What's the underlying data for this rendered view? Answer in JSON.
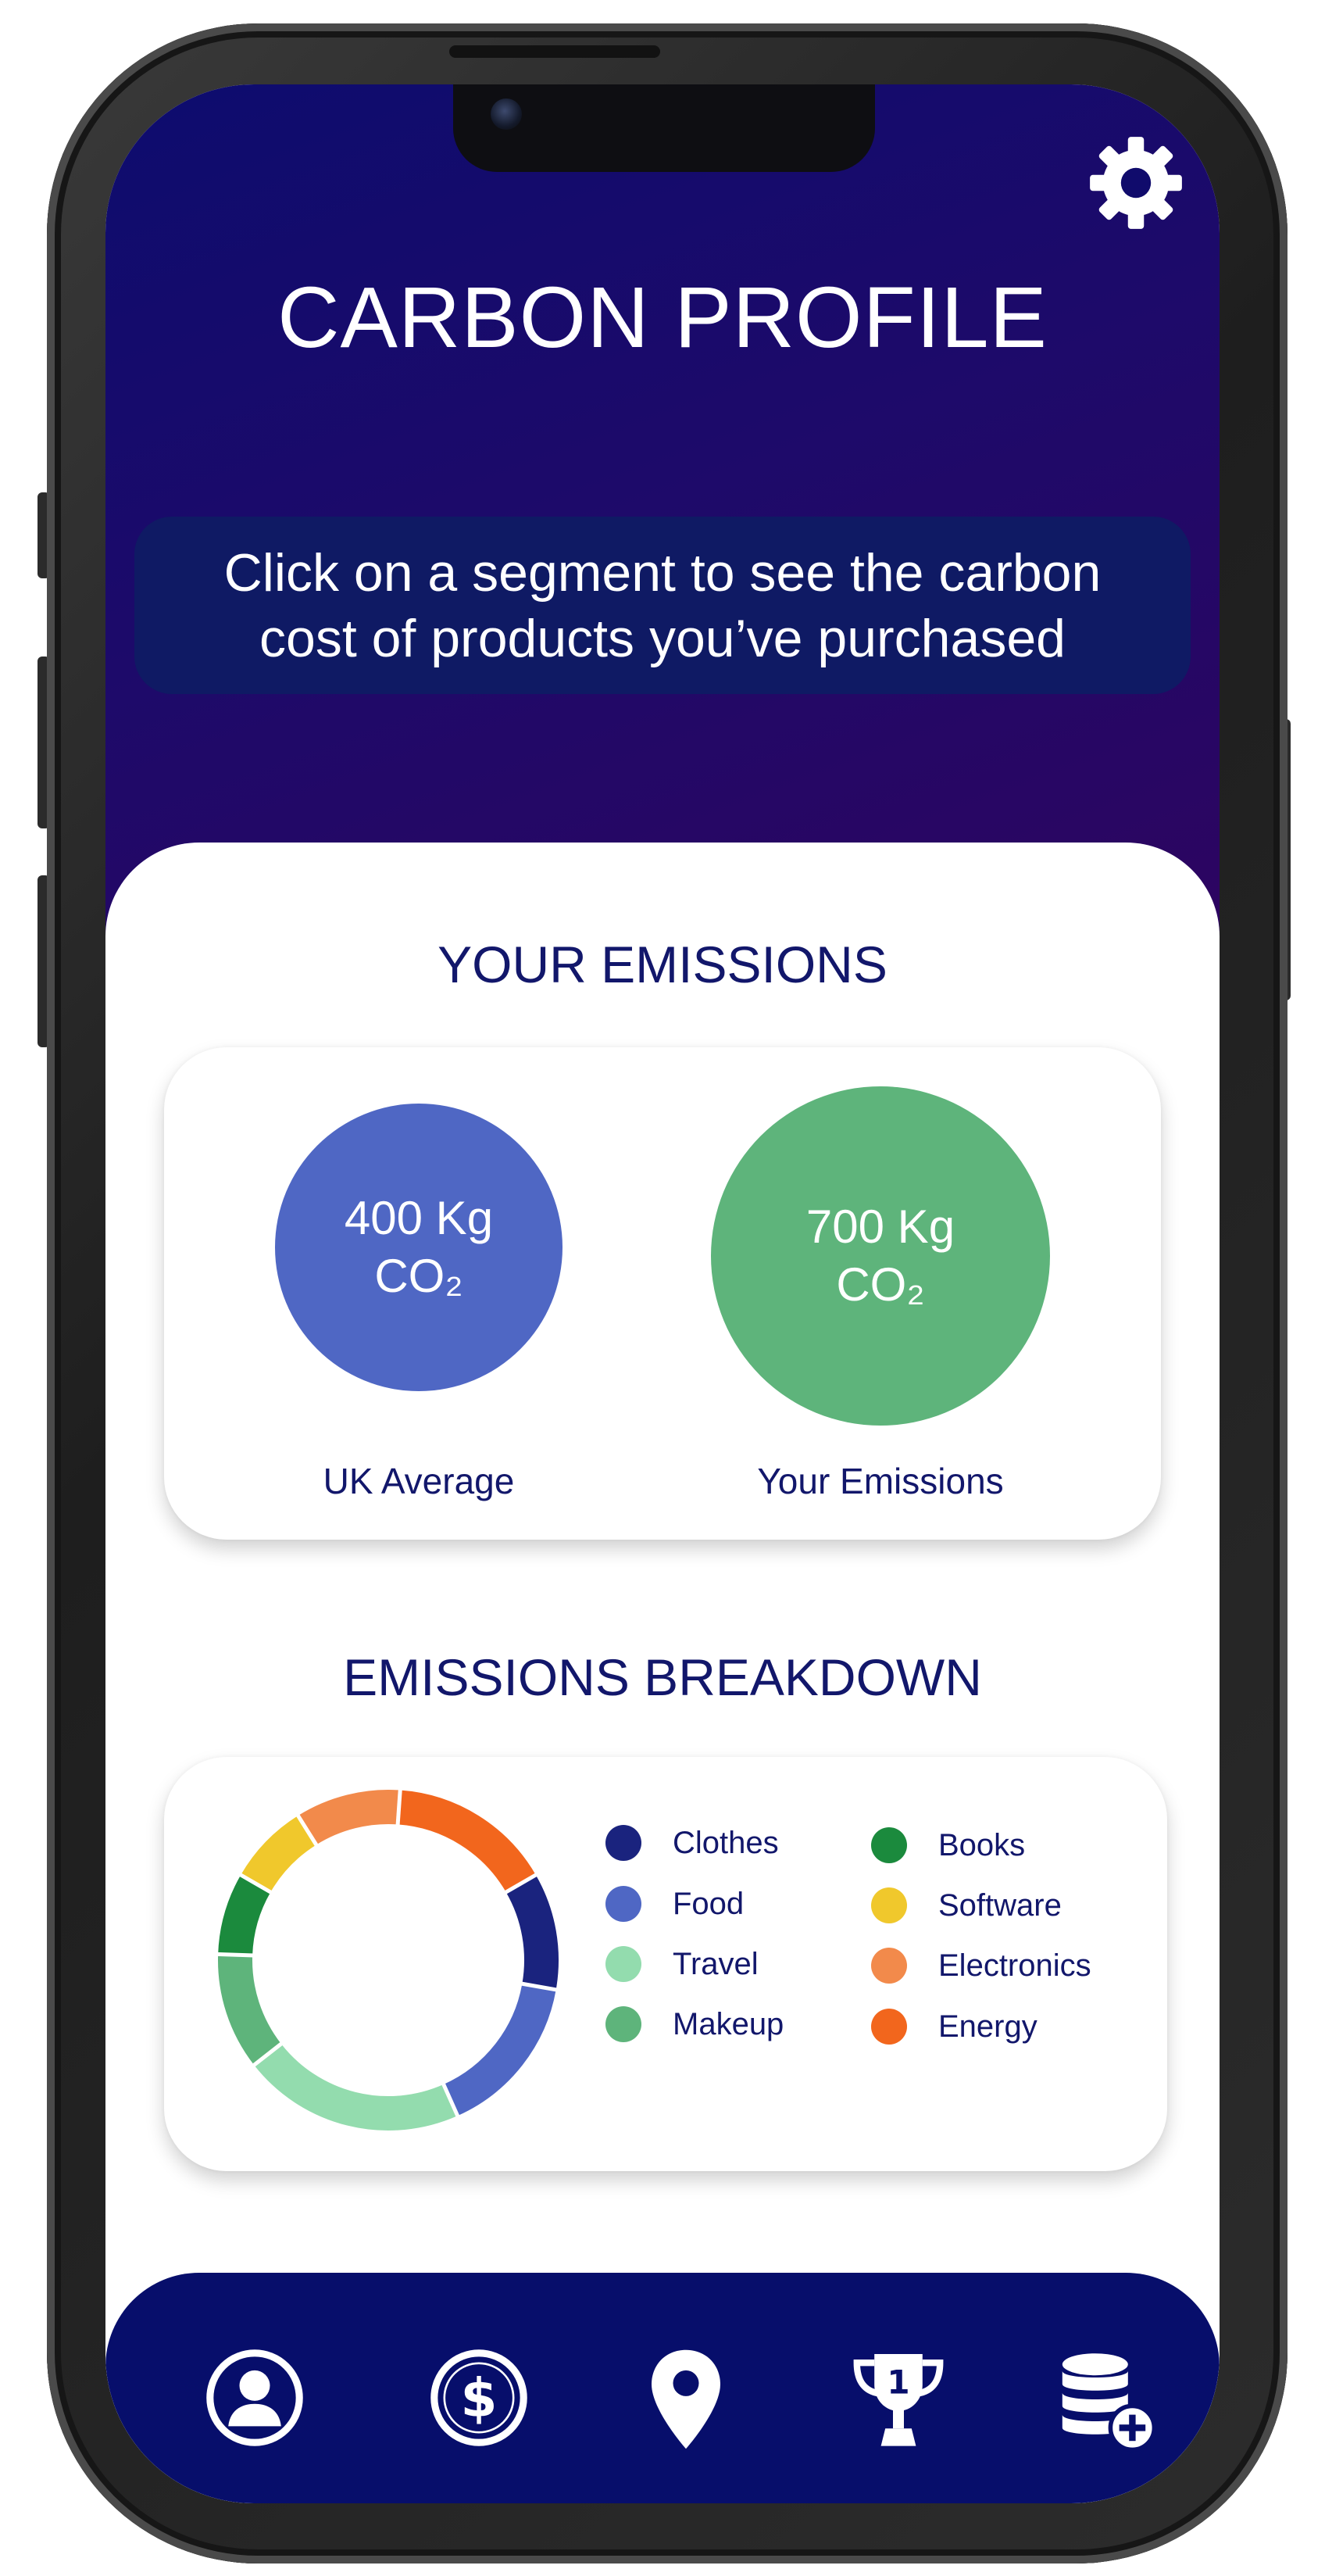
{
  "header": {
    "title": "CARBON PROFILE",
    "instruction_line1": "Click on a segment to see the carbon",
    "instruction_line2": "cost of products you’ve purchased",
    "settings_icon": "gear-icon"
  },
  "emissions": {
    "title": "YOUR EMISSIONS",
    "uk_average": {
      "value": "400 Kg",
      "unit": "CO₂",
      "label": "UK Average",
      "color": "#4f67c4"
    },
    "yours": {
      "value": "700 Kg",
      "unit": "CO₂",
      "label": "Your Emissions",
      "color": "#5eb47b"
    }
  },
  "breakdown": {
    "title": "EMISSIONS BREAKDOWN",
    "legend": [
      {
        "label": "Clothes",
        "color": "#1a237e"
      },
      {
        "label": "Food",
        "color": "#4f67c4"
      },
      {
        "label": "Travel",
        "color": "#93dcae"
      },
      {
        "label": "Makeup",
        "color": "#5eb47b"
      },
      {
        "label": "Books",
        "color": "#1b8a3d"
      },
      {
        "label": "Software",
        "color": "#f0c82c"
      },
      {
        "label": "Electronics",
        "color": "#f28a4b"
      },
      {
        "label": "Energy",
        "color": "#f2661d"
      }
    ]
  },
  "nav": [
    {
      "name": "profile",
      "icon": "user-circle-icon"
    },
    {
      "name": "spending",
      "icon": "dollar-circle-icon"
    },
    {
      "name": "location",
      "icon": "map-pin-icon"
    },
    {
      "name": "leaderboard",
      "icon": "trophy-icon"
    },
    {
      "name": "add-data",
      "icon": "database-plus-icon"
    }
  ],
  "chart_data": {
    "type": "pie",
    "categories": [
      "Energy",
      "Clothes",
      "Food",
      "Travel",
      "Makeup",
      "Books",
      "Software",
      "Electronics"
    ],
    "values": [
      14,
      10,
      14,
      19,
      10,
      7,
      7,
      9
    ],
    "colors": [
      "#f2661d",
      "#1a237e",
      "#4f67c4",
      "#93dcae",
      "#5eb47b",
      "#1b8a3d",
      "#f0c82c",
      "#f28a4b"
    ]
  }
}
